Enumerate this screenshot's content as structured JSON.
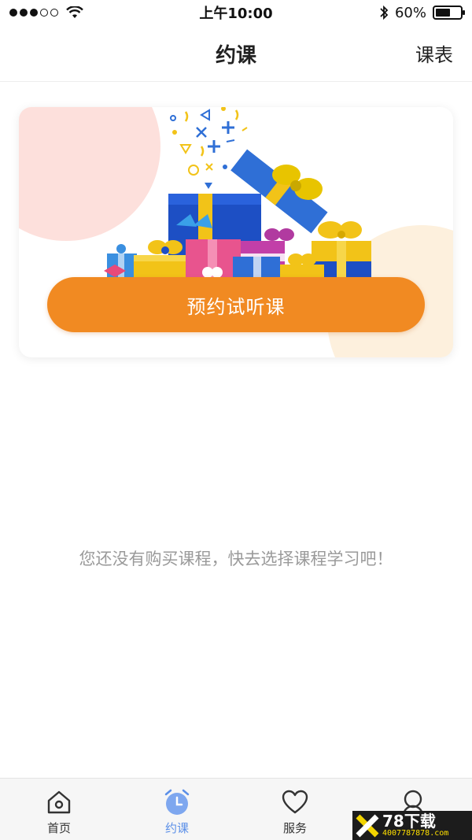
{
  "status_bar": {
    "time": "上午10:00",
    "battery_percent": "60%",
    "battery_level": 0.6,
    "signal_bars_filled": 3,
    "signal_bars_total": 5
  },
  "nav": {
    "title": "约课",
    "right_action": "课表"
  },
  "card": {
    "cta_label": "预约试听课",
    "colors": {
      "button": "#f18a22",
      "blob_pink": "#fde0dc",
      "blob_cream": "#fdf0dd"
    }
  },
  "empty_state": {
    "message": "您还没有购买课程，快去选择课程学习吧！"
  },
  "tab_bar": {
    "active_color": "#5b8fe8",
    "tabs": [
      {
        "label": "首页",
        "icon": "home-icon"
      },
      {
        "label": "约课",
        "icon": "alarm-clock-icon",
        "active": true
      },
      {
        "label": "服务",
        "icon": "heart-icon"
      },
      {
        "label": "",
        "icon": "user-icon"
      }
    ]
  },
  "watermark": {
    "title": "78下载",
    "subtitle": "4007787878.com"
  }
}
